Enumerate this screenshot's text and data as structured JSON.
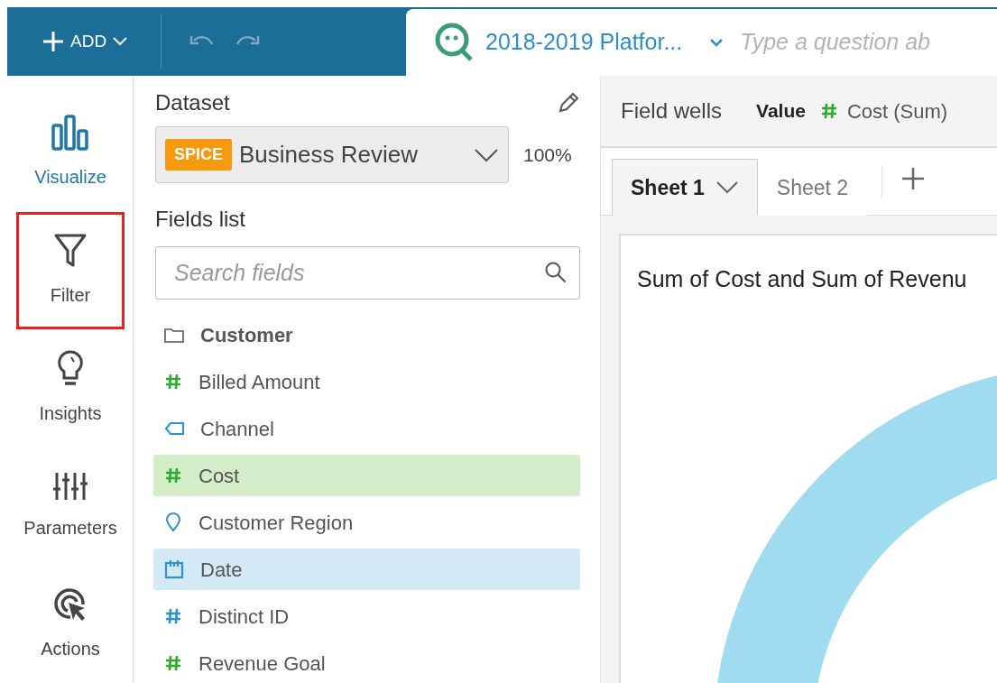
{
  "toolbar": {
    "add_label": "ADD",
    "analysis_title": "2018-2019 Platfor...",
    "question_placeholder": "Type a question ab"
  },
  "rail": [
    {
      "kind": "visualize",
      "label": "Visualize",
      "selected": true,
      "highlighted": false
    },
    {
      "kind": "filter",
      "label": "Filter",
      "selected": false,
      "highlighted": true
    },
    {
      "kind": "insights",
      "label": "Insights",
      "selected": false,
      "highlighted": false
    },
    {
      "kind": "parameters",
      "label": "Parameters",
      "selected": false,
      "highlighted": false
    },
    {
      "kind": "actions",
      "label": "Actions",
      "selected": false,
      "highlighted": false
    }
  ],
  "dataset": {
    "heading": "Dataset",
    "badge": "SPICE",
    "name": "Business Review",
    "usage": "100%"
  },
  "fields": {
    "heading": "Fields list",
    "placeholder": "Search fields",
    "items": [
      {
        "kind": "folder",
        "label": "Customer",
        "highlighted": false
      },
      {
        "kind": "measure",
        "label": "Billed Amount",
        "highlighted": false
      },
      {
        "kind": "text",
        "label": "Channel",
        "highlighted": false
      },
      {
        "kind": "measure",
        "label": "Cost",
        "highlighted": true
      },
      {
        "kind": "geo",
        "label": "Customer Region",
        "highlighted": false
      },
      {
        "kind": "date",
        "label": "Date",
        "highlighted": true
      },
      {
        "kind": "number",
        "label": "Distinct ID",
        "highlighted": false
      },
      {
        "kind": "measure",
        "label": "Revenue Goal",
        "highlighted": false
      }
    ]
  },
  "field_wells": {
    "heading": "Field wells",
    "well_label": "Value",
    "well_field": "Cost (Sum)"
  },
  "sheets": [
    {
      "label": "Sheet 1",
      "selected": true
    },
    {
      "label": "Sheet 2",
      "selected": false
    }
  ],
  "visual": {
    "title": "Sum of Cost and Sum of Revenu"
  }
}
